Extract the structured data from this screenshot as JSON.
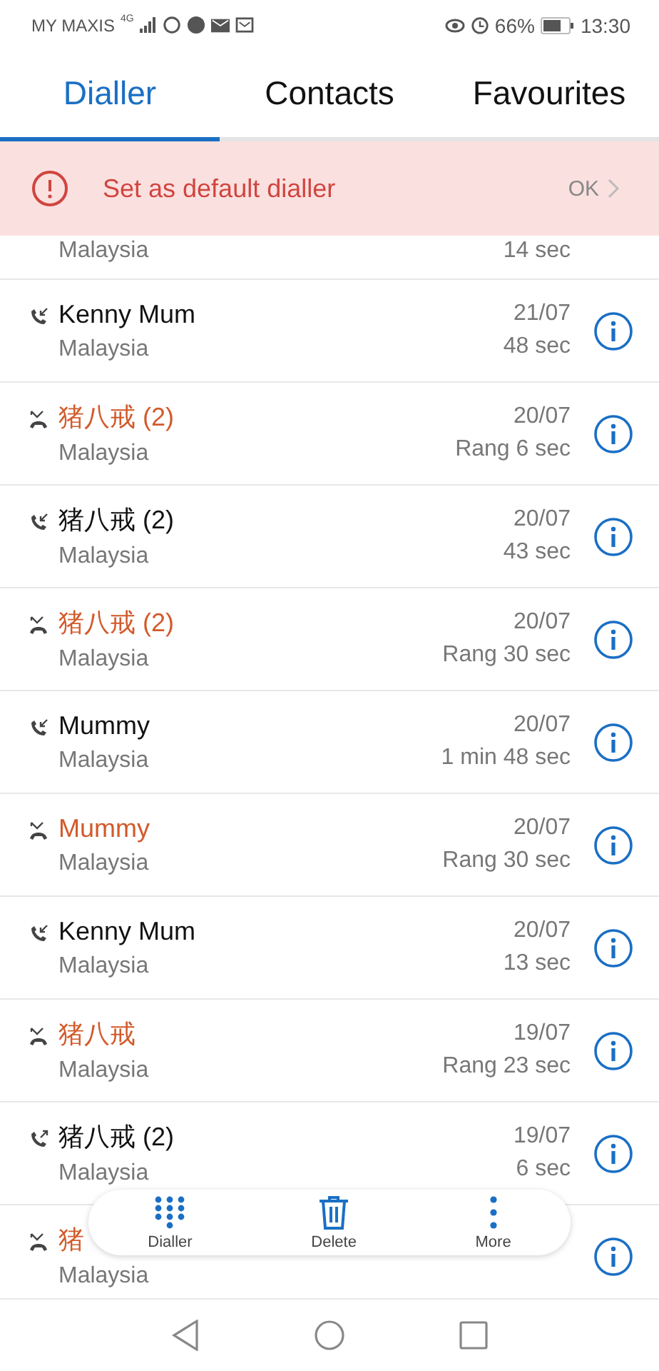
{
  "status_bar": {
    "carrier": "MY MAXIS",
    "network": "4G",
    "battery": "66%",
    "time": "13:30"
  },
  "tabs": [
    {
      "label": "Dialler",
      "selected": true
    },
    {
      "label": "Contacts",
      "selected": false
    },
    {
      "label": "Favourites",
      "selected": false
    }
  ],
  "banner": {
    "message": "Set as default dialler",
    "action": "OK"
  },
  "calls": [
    {
      "kind": "partial",
      "subtitle": "Malaysia",
      "detail": "14 sec"
    },
    {
      "kind": "incoming",
      "name": "Kenny Mum",
      "subtitle": "Malaysia",
      "date": "21/07",
      "detail": "48 sec",
      "missed": false
    },
    {
      "kind": "missed",
      "name": "猪八戒 (2)",
      "subtitle": "Malaysia",
      "date": "20/07",
      "detail": "Rang 6 sec",
      "missed": true
    },
    {
      "kind": "incoming",
      "name": "猪八戒 (2)",
      "subtitle": "Malaysia",
      "date": "20/07",
      "detail": "43 sec",
      "missed": false
    },
    {
      "kind": "missed",
      "name": "猪八戒 (2)",
      "subtitle": "Malaysia",
      "date": "20/07",
      "detail": "Rang 30 sec",
      "missed": true
    },
    {
      "kind": "incoming",
      "name": "Mummy",
      "subtitle": "Malaysia",
      "date": "20/07",
      "detail": "1 min 48 sec",
      "missed": false
    },
    {
      "kind": "missed",
      "name": "Mummy",
      "subtitle": "Malaysia",
      "date": "20/07",
      "detail": "Rang 30 sec",
      "missed": true
    },
    {
      "kind": "incoming",
      "name": "Kenny Mum",
      "subtitle": "Malaysia",
      "date": "20/07",
      "detail": "13 sec",
      "missed": false
    },
    {
      "kind": "missed",
      "name": "猪八戒",
      "subtitle": "Malaysia",
      "date": "19/07",
      "detail": "Rang 23 sec",
      "missed": true
    },
    {
      "kind": "outgoing",
      "name": "猪八戒 (2)",
      "subtitle": "Malaysia",
      "date": "19/07",
      "detail": "6 sec",
      "missed": false
    },
    {
      "kind": "missed",
      "name": "猪",
      "subtitle": "Malaysia",
      "missed": true
    }
  ],
  "action_bar": [
    {
      "kind": "dialpad",
      "label": "Dialler"
    },
    {
      "kind": "delete",
      "label": "Delete"
    },
    {
      "kind": "more",
      "label": "More"
    }
  ]
}
